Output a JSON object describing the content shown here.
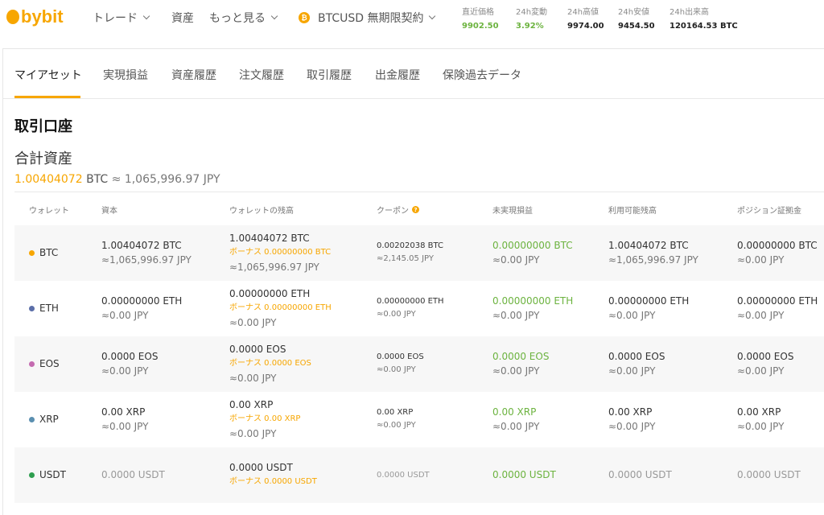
{
  "brand": {
    "name": "bybit",
    "color": "#f7a600"
  },
  "nav": {
    "trade": "トレード",
    "assets": "資産",
    "more": "もっと見る",
    "symbol": "BTCUSD 無期限契約",
    "symbol_icon": "₿"
  },
  "ticker": [
    {
      "label": "直近価格",
      "value": "9902.50"
    },
    {
      "label": "24h変動",
      "value": "3.92%"
    },
    {
      "label": "24h高値",
      "value": "9974.00"
    },
    {
      "label": "24h安値",
      "value": "9454.50"
    },
    {
      "label": "24h出来高",
      "value": "120164.53 BTC"
    }
  ],
  "tabs": [
    "マイアセット",
    "実現損益",
    "資産履歴",
    "注文履歴",
    "取引履歴",
    "出金履歴",
    "保険過去データ"
  ],
  "section_title": "取引口座",
  "total": {
    "title": "合計資産",
    "amount": "1.00404072",
    "unit": " BTC",
    "jpy": " ≈ 1,065,996.97 JPY"
  },
  "columns": [
    "ウォレット",
    "資本",
    "ウォレットの残高",
    "クーポン",
    "未実現損益",
    "利用可能残高",
    "ポジション証拠金"
  ],
  "coupon_help_icon": "?",
  "rows": [
    {
      "wallet": "BTC",
      "dot_color": "#f7a600",
      "capital": "1.00404072 BTC",
      "capital_jpy": "≈1,065,996.97 JPY",
      "balance": "1.00404072 BTC",
      "bonus": "ボーナス 0.00000000 BTC",
      "balance_jpy": "≈1,065,996.97 JPY",
      "coupon": "0.00202038 BTC",
      "coupon_jpy": "≈2,145.05 JPY",
      "unrealized": "0.00000000 BTC",
      "unrealized_jpy": "≈0.00 JPY",
      "available": "1.00404072 BTC",
      "available_jpy": "≈1,065,996.97 JPY",
      "margin": "0.00000000 BTC",
      "margin_jpy": "≈0.00 JPY"
    },
    {
      "wallet": "ETH",
      "dot_color": "#5b6ea8",
      "capital": "0.00000000 ETH",
      "capital_jpy": "≈0.00 JPY",
      "balance": "0.00000000 ETH",
      "bonus": "ボーナス 0.00000000 ETH",
      "balance_jpy": "≈0.00 JPY",
      "coupon": "0.00000000 ETH",
      "coupon_jpy": "≈0.00 JPY",
      "unrealized": "0.00000000 ETH",
      "unrealized_jpy": "≈0.00 JPY",
      "available": "0.00000000 ETH",
      "available_jpy": "≈0.00 JPY",
      "margin": "0.00000000 ETH",
      "margin_jpy": "≈0.00 JPY"
    },
    {
      "wallet": "EOS",
      "dot_color": "#c46bb0",
      "capital": "0.0000 EOS",
      "capital_jpy": "≈0.00 JPY",
      "balance": "0.0000 EOS",
      "bonus": "ボーナス 0.0000 EOS",
      "balance_jpy": "≈0.00 JPY",
      "coupon": "0.0000 EOS",
      "coupon_jpy": "≈0.00 JPY",
      "unrealized": "0.0000 EOS",
      "unrealized_jpy": "≈0.00 JPY",
      "available": "0.0000 EOS",
      "available_jpy": "≈0.00 JPY",
      "margin": "0.0000 EOS",
      "margin_jpy": "≈0.00 JPY"
    },
    {
      "wallet": "XRP",
      "dot_color": "#5a8fb0",
      "capital": "0.00 XRP",
      "capital_jpy": "≈0.00 JPY",
      "balance": "0.00 XRP",
      "bonus": "ボーナス 0.00 XRP",
      "balance_jpy": "≈0.00 JPY",
      "coupon": "0.00 XRP",
      "coupon_jpy": "≈0.00 JPY",
      "unrealized": "0.00 XRP",
      "unrealized_jpy": "≈0.00 JPY",
      "available": "0.00 XRP",
      "available_jpy": "≈0.00 JPY",
      "margin": "0.00 XRP",
      "margin_jpy": "≈0.00 JPY"
    },
    {
      "wallet": "USDT",
      "dot_color": "#2e9e4f",
      "capital": "0.0000 USDT",
      "balance": "0.0000 USDT",
      "bonus": "ボーナス 0.0000 USDT",
      "coupon": "0.0000 USDT",
      "unrealized": "0.0000 USDT",
      "available": "0.0000 USDT",
      "margin": "0.0000 USDT"
    }
  ],
  "colors": {
    "accent": "#f7a600",
    "positive": "#6cb33f"
  }
}
